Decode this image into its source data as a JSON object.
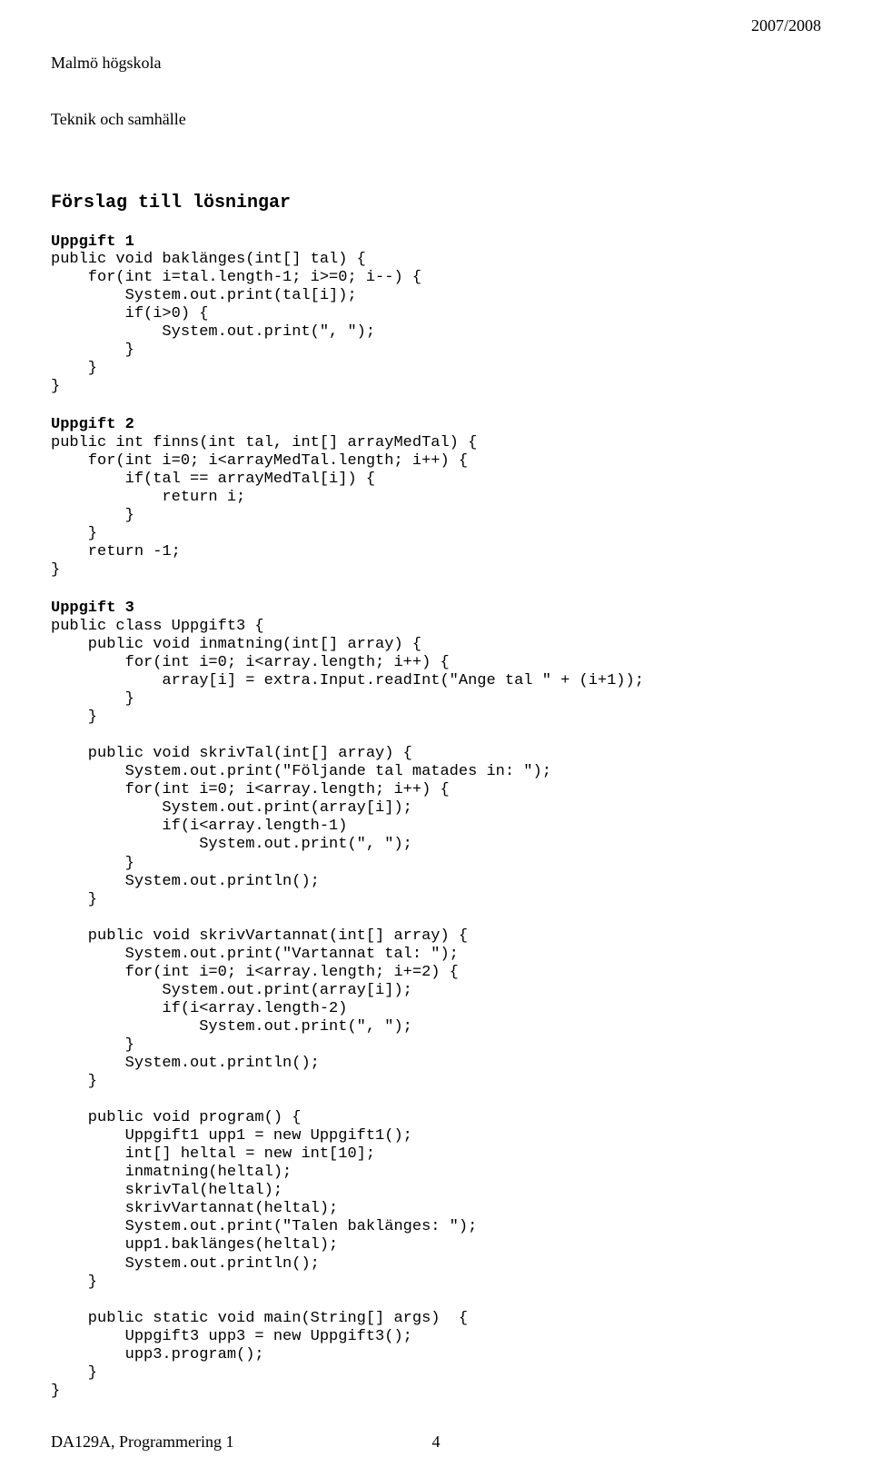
{
  "header": {
    "institution_line1": "Malmö högskola",
    "institution_line2": "Teknik och samhälle",
    "year": "2007/2008"
  },
  "title": "Förslag till lösningar",
  "sections": {
    "u1": {
      "heading": "Uppgift 1",
      "code": "public void baklänges(int[] tal) {\n    for(int i=tal.length-1; i>=0; i--) {\n        System.out.print(tal[i]);\n        if(i>0) {\n            System.out.print(\", \");\n        }\n    }\n}"
    },
    "u2": {
      "heading": "Uppgift 2",
      "code": "public int finns(int tal, int[] arrayMedTal) {\n    for(int i=0; i<arrayMedTal.length; i++) {\n        if(tal == arrayMedTal[i]) {\n            return i;\n        }\n    }\n    return -1;\n}"
    },
    "u3": {
      "heading": "Uppgift 3",
      "code": "public class Uppgift3 {\n    public void inmatning(int[] array) {\n        for(int i=0; i<array.length; i++) {\n            array[i] = extra.Input.readInt(\"Ange tal \" + (i+1));\n        }\n    }\n\n    public void skrivTal(int[] array) {\n        System.out.print(\"Följande tal matades in: \");\n        for(int i=0; i<array.length; i++) {\n            System.out.print(array[i]);\n            if(i<array.length-1)\n                System.out.print(\", \");\n        }\n        System.out.println();\n    }\n\n    public void skrivVartannat(int[] array) {\n        System.out.print(\"Vartannat tal: \");\n        for(int i=0; i<array.length; i+=2) {\n            System.out.print(array[i]);\n            if(i<array.length-2)\n                System.out.print(\", \");\n        }\n        System.out.println();\n    }\n\n    public void program() {\n        Uppgift1 upp1 = new Uppgift1();\n        int[] heltal = new int[10];\n        inmatning(heltal);\n        skrivTal(heltal);\n        skrivVartannat(heltal);\n        System.out.print(\"Talen baklänges: \");\n        upp1.baklänges(heltal);\n        System.out.println();\n    }\n\n    public static void main(String[] args)  {\n        Uppgift3 upp3 = new Uppgift3();\n        upp3.program();\n    }\n}"
    }
  },
  "footer": {
    "course": "DA129A, Programmering 1",
    "page_no": "4"
  }
}
